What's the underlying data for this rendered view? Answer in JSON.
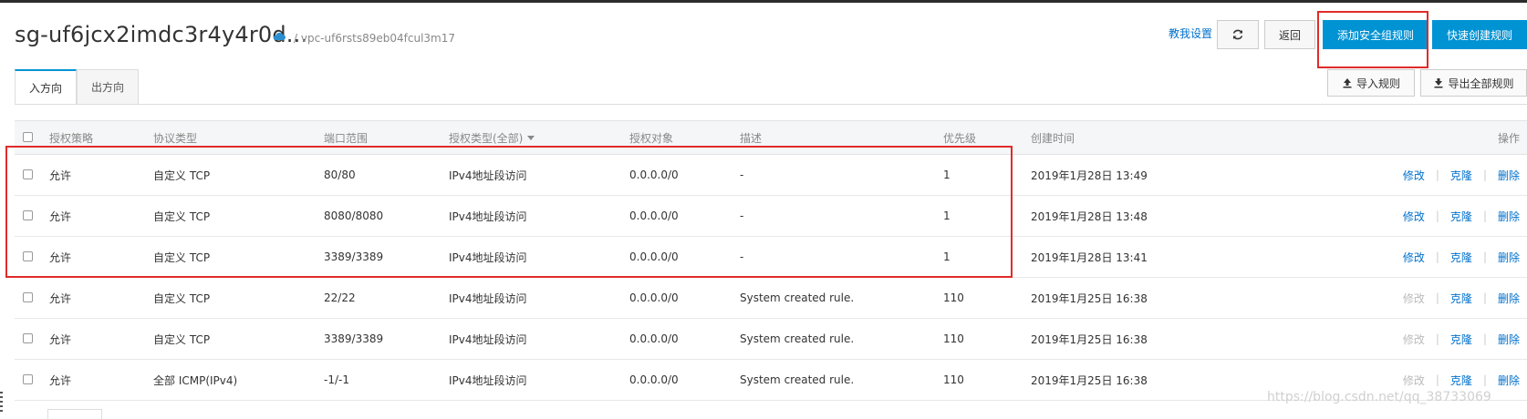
{
  "header": {
    "title": "sg-uf6jcx2imdc3r4y4r0d...",
    "breadcrumb": "/ vpc-uf6rsts89eb04fcul3m17",
    "help_link": "教我设置",
    "back_label": "返回",
    "add_rule_label": "添加安全组规则",
    "quick_create_label": "快速创建规则"
  },
  "tabs": [
    {
      "label": "入方向",
      "active": true
    },
    {
      "label": "出方向",
      "active": false
    }
  ],
  "actions": {
    "import_label": "导入规则",
    "export_label": "导出全部规则"
  },
  "table": {
    "columns": {
      "policy": "授权策略",
      "protocol": "协议类型",
      "port": "端口范围",
      "auth_type": "授权类型(全部)",
      "object": "授权对象",
      "desc": "描述",
      "priority": "优先级",
      "created": "创建时间",
      "ops": "操作"
    },
    "rows": [
      {
        "policy": "允许",
        "protocol": "自定义 TCP",
        "port": "80/80",
        "auth_type": "IPv4地址段访问",
        "object": "0.0.0.0/0",
        "desc": "-",
        "priority": "1",
        "created": "2019年1月28日 13:49",
        "modify": "修改",
        "clone": "克隆",
        "delete": "删除",
        "modify_enabled": true
      },
      {
        "policy": "允许",
        "protocol": "自定义 TCP",
        "port": "8080/8080",
        "auth_type": "IPv4地址段访问",
        "object": "0.0.0.0/0",
        "desc": "-",
        "priority": "1",
        "created": "2019年1月28日 13:48",
        "modify": "修改",
        "clone": "克隆",
        "delete": "删除",
        "modify_enabled": true
      },
      {
        "policy": "允许",
        "protocol": "自定义 TCP",
        "port": "3389/3389",
        "auth_type": "IPv4地址段访问",
        "object": "0.0.0.0/0",
        "desc": "-",
        "priority": "1",
        "created": "2019年1月28日 13:41",
        "modify": "修改",
        "clone": "克隆",
        "delete": "删除",
        "modify_enabled": true
      },
      {
        "policy": "允许",
        "protocol": "自定义 TCP",
        "port": "22/22",
        "auth_type": "IPv4地址段访问",
        "object": "0.0.0.0/0",
        "desc": "System created rule.",
        "priority": "110",
        "created": "2019年1月25日 16:38",
        "modify": "修改",
        "clone": "克隆",
        "delete": "删除",
        "modify_enabled": false
      },
      {
        "policy": "允许",
        "protocol": "自定义 TCP",
        "port": "3389/3389",
        "auth_type": "IPv4地址段访问",
        "object": "0.0.0.0/0",
        "desc": "System created rule.",
        "priority": "110",
        "created": "2019年1月25日 16:38",
        "modify": "修改",
        "clone": "克隆",
        "delete": "删除",
        "modify_enabled": false
      },
      {
        "policy": "允许",
        "protocol": "全部 ICMP(IPv4)",
        "port": "-1/-1",
        "auth_type": "IPv4地址段访问",
        "object": "0.0.0.0/0",
        "desc": "System created rule.",
        "priority": "110",
        "created": "2019年1月25日 16:38",
        "modify": "修改",
        "clone": "克隆",
        "delete": "删除",
        "modify_enabled": false
      }
    ]
  },
  "watermark": "https://blog.csdn.net/qq_38733069",
  "colors": {
    "primary": "#0093d4",
    "link": "#0070cc",
    "highlight_border": "#e02b2b"
  },
  "icons": [
    "cloud-icon",
    "refresh-icon",
    "upload-icon",
    "download-icon",
    "caret-down-icon"
  ]
}
